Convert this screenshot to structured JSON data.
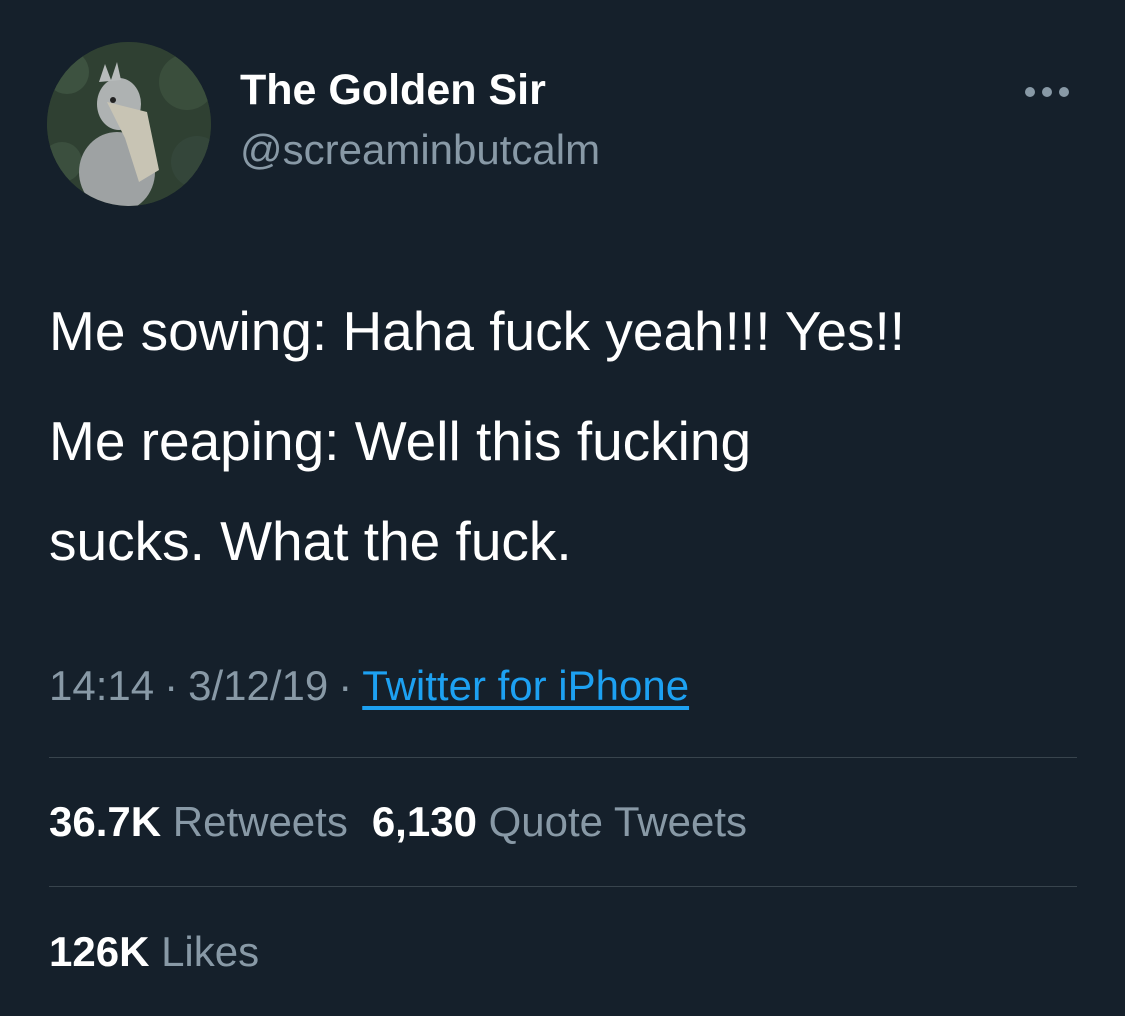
{
  "author": {
    "display_name": "The Golden Sir",
    "handle": "@screaminbutcalm",
    "avatar_icon": "shoebill-avatar"
  },
  "more_icon": "more-horizontal-icon",
  "tweet": {
    "lines": [
      "Me sowing: Haha fuck yeah!!! Yes!!",
      "Me reaping: Well this fucking",
      "sucks. What the fuck."
    ]
  },
  "meta": {
    "time": "14:14",
    "separator": "·",
    "date": "3/12/19",
    "source": "Twitter for iPhone"
  },
  "stats": {
    "retweets": {
      "count": "36.7K",
      "label": "Retweets"
    },
    "quote_tweets": {
      "count": "6,130",
      "label": "Quote Tweets"
    },
    "likes": {
      "count": "126K",
      "label": "Likes"
    }
  },
  "colors": {
    "background": "#15202b",
    "secondary_text": "#8899a6",
    "link": "#1da1f2",
    "divider": "#38444d"
  }
}
